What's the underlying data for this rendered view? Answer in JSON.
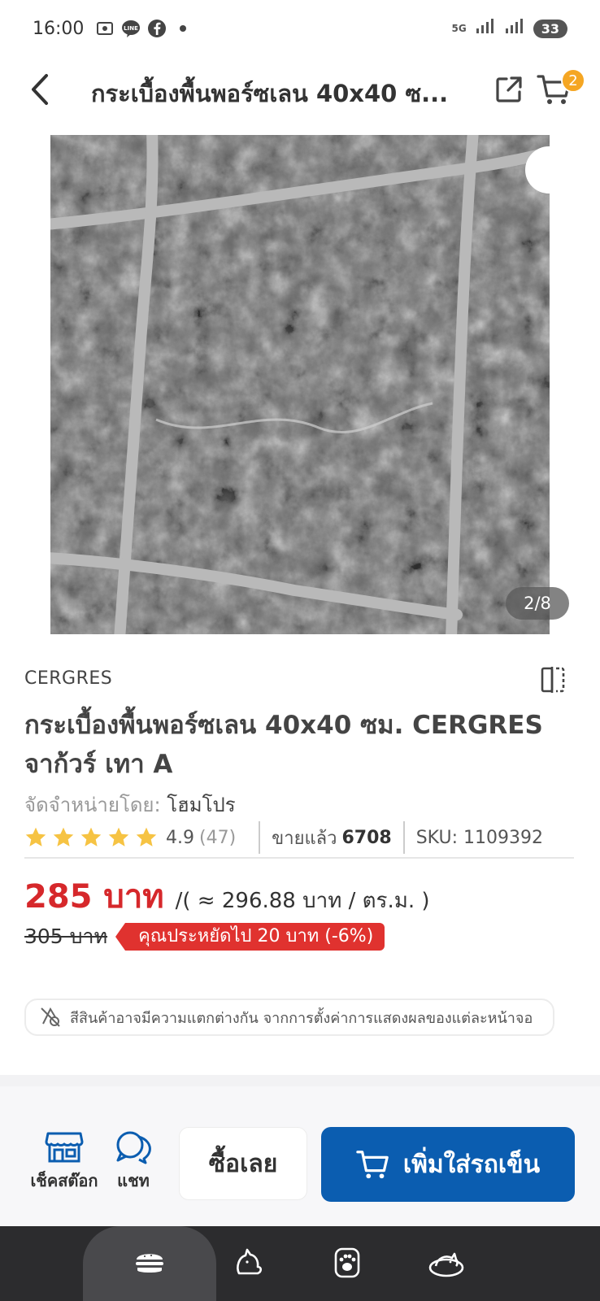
{
  "status_bar": {
    "time": "16:00",
    "left_icons": [
      "screenshot-icon",
      "line-icon",
      "facebook-icon",
      "dot-icon"
    ],
    "network": "5G",
    "battery": "33"
  },
  "header": {
    "title": "กระเบื้องพื้นพอร์ซเลน  40x40 ซ...",
    "cart_count": "2"
  },
  "gallery": {
    "counter": "2/8"
  },
  "product": {
    "brand": "CERGRES",
    "title": "กระเบื้องพื้นพอร์ซเลน  40x40 ซม. CERGRES จาก้วร์ เทา A",
    "sold_by_label": "จัดจำหน่ายโดย:",
    "seller": "โฮมโปร",
    "rating": "4.9",
    "rating_count": "(47)",
    "sold_label": "ขายแล้ว",
    "sold_count": "6708",
    "sku": "SKU: 1109392",
    "price": "285 บาท",
    "price_per_unit": "/( ≈ 296.88 บาท / ตร.ม. )",
    "old_price": "305 บาท",
    "save_text": "คุณประหยัดไป 20 บาท (-6%)",
    "note": "สีสินค้าอาจมีความแตกต่างกัน จากการตั้งค่าการแสดงผลของแต่ละหน้าจอ",
    "star_count": 5
  },
  "actions": {
    "check_stock": "เช็คสต๊อก",
    "chat": "แชท",
    "buy_now": "ซื้อเลย",
    "add_to_cart": "เพิ่มใส่รถเข็น"
  },
  "nav": {
    "items": [
      "burger-icon",
      "cat-icon",
      "paw-icon",
      "cat-bed-icon"
    ]
  },
  "colors": {
    "price": "#d6282b",
    "primary": "#0b5db0",
    "star": "#f6c343",
    "badge": "#f5a623",
    "save_badge": "#e0322f"
  }
}
